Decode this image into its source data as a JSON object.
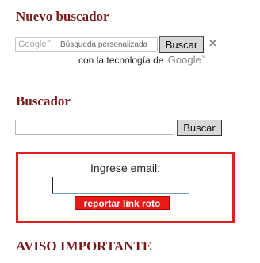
{
  "section1": {
    "heading": "Nuevo buscador",
    "google_logo": "Google",
    "google_logo_tm": "™",
    "search_placeholder": "Búsqueda personalizada",
    "search_button": "Buscar",
    "close_icon": "close-icon",
    "close_glyph": "✕",
    "powered_text": "con la tecnología de",
    "powered_logo": "Google",
    "powered_logo_tm": "™"
  },
  "section2": {
    "heading": "Buscador",
    "search_value": "",
    "search_button": "Buscar"
  },
  "report": {
    "label": "Ingrese email:",
    "email_value": "",
    "button": "reportar link roto",
    "border_color": "#e02020",
    "button_color": "#e81a1a"
  },
  "section3": {
    "heading": "AVISO IMPORTANTE"
  },
  "colors": {
    "heading": "#7a1a1a"
  }
}
